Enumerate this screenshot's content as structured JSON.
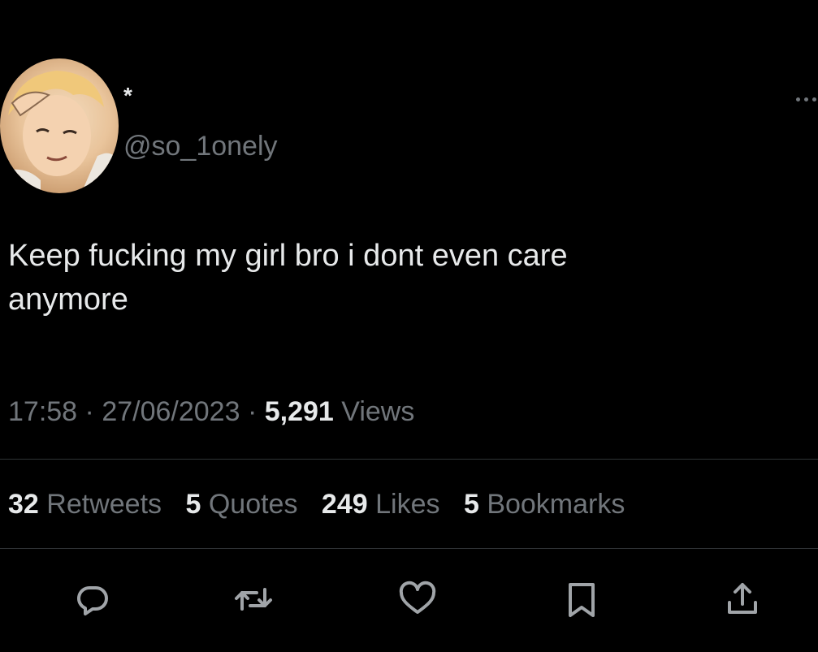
{
  "tweet": {
    "display_name": "*",
    "handle": "@so_1onely",
    "text": "Keep fucking my girl bro i dont even care\nanymore",
    "time": "17:58",
    "date": "27/06/2023",
    "views_count": "5,291",
    "views_label": "Views",
    "separator": "·"
  },
  "stats": [
    {
      "count": "32",
      "label": "Retweets"
    },
    {
      "count": "5",
      "label": "Quotes"
    },
    {
      "count": "249",
      "label": "Likes"
    },
    {
      "count": "5",
      "label": "Bookmarks"
    }
  ],
  "actions": [
    {
      "name": "reply",
      "icon": "reply-icon"
    },
    {
      "name": "retweet",
      "icon": "retweet-icon"
    },
    {
      "name": "like",
      "icon": "heart-icon"
    },
    {
      "name": "bookmark",
      "icon": "bookmark-icon"
    },
    {
      "name": "share",
      "icon": "share-icon"
    }
  ],
  "colors": {
    "background": "#000000",
    "primary_text": "#e7e9ea",
    "secondary_text": "#71767b",
    "divider": "#2f3336"
  }
}
